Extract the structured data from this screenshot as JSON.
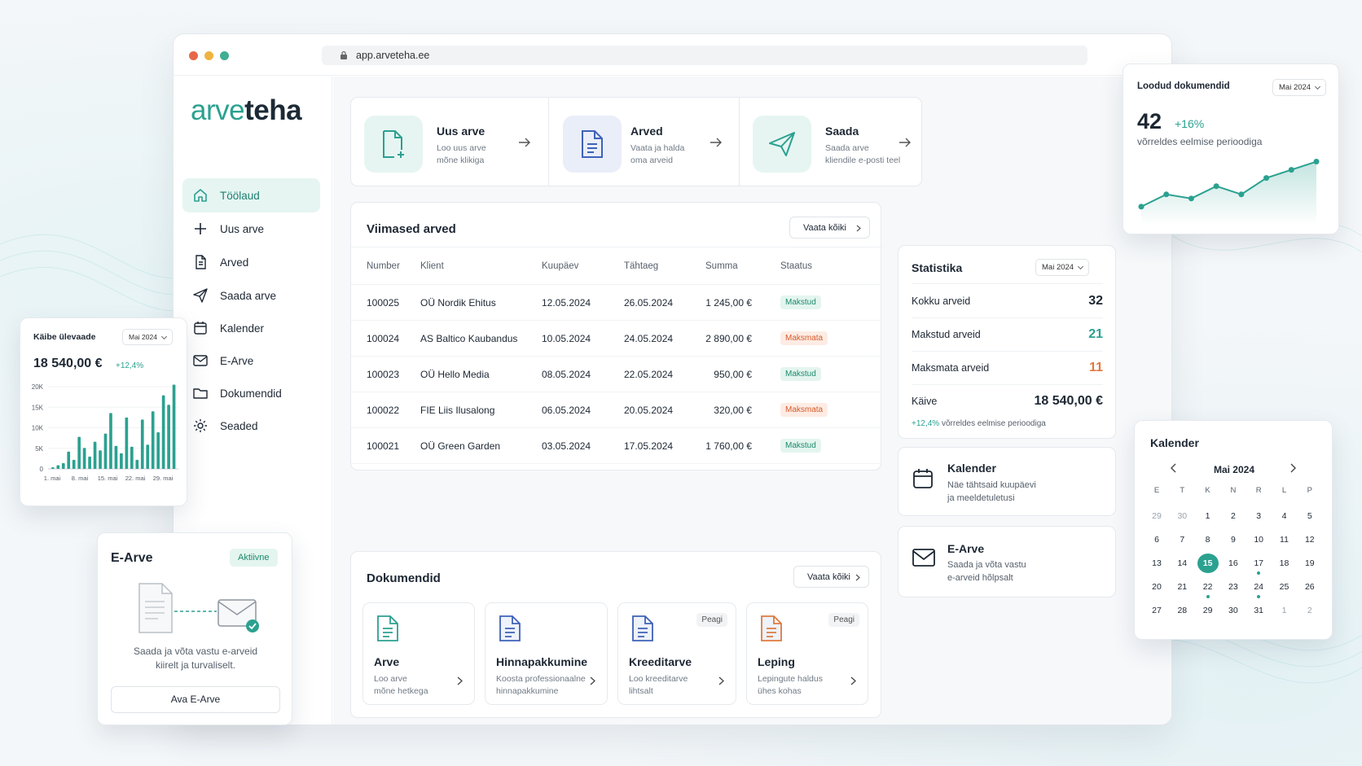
{
  "browser": {
    "url": "app.arveteha.ee"
  },
  "brand": {
    "logo_a": "arve",
    "logo_b": "teha",
    "accent": "#2ba190"
  },
  "sidebar": {
    "items": [
      {
        "label": "Töölaud",
        "icon": "home-icon",
        "active": true
      },
      {
        "label": "Uus arve",
        "icon": "plus-icon"
      },
      {
        "label": "Arved",
        "icon": "document-icon"
      },
      {
        "label": "Saada arve",
        "icon": "send-icon"
      },
      {
        "label": "Kalender",
        "icon": "calendar-icon"
      },
      {
        "label": "E-Arve",
        "icon": "mail-icon"
      },
      {
        "label": "Dokumendid",
        "icon": "folder-icon"
      },
      {
        "label": "Seaded",
        "icon": "gear-icon"
      }
    ]
  },
  "quick_actions": [
    {
      "title": "Uus arve",
      "desc1": "Loo uus arve",
      "desc2": "mõne klikiga",
      "icon": "new-document-icon"
    },
    {
      "title": "Arved",
      "desc1": "Vaata ja halda",
      "desc2": "oma arveid",
      "icon": "document-icon"
    },
    {
      "title": "Saada",
      "desc1": "Saada arve",
      "desc2": "kliendile e-posti teel",
      "icon": "send-icon"
    }
  ],
  "invoices": {
    "title": "Viimased arved",
    "view_all": "Vaata kõiki",
    "columns": [
      "Number",
      "Klient",
      "Kuupäev",
      "Tähtaeg",
      "Summa",
      "Staatus"
    ],
    "rows": [
      {
        "number": "100025",
        "client": "OÜ Nordik Ehitus",
        "date": "12.05.2024",
        "due": "26.05.2024",
        "sum": "1 245,00 €",
        "status": "Makstud"
      },
      {
        "number": "100024",
        "client": "AS Baltico Kaubandus",
        "date": "10.05.2024",
        "due": "24.05.2024",
        "sum": "2 890,00 €",
        "status": "Maksmata"
      },
      {
        "number": "100023",
        "client": "OÜ Hello Media",
        "date": "08.05.2024",
        "due": "22.05.2024",
        "sum": "950,00 €",
        "status": "Makstud"
      },
      {
        "number": "100022",
        "client": "FIE Liis Ilusalong",
        "date": "06.05.2024",
        "due": "20.05.2024",
        "sum": "320,00 €",
        "status": "Maksmata"
      },
      {
        "number": "100021",
        "client": "OÜ Green Garden",
        "date": "03.05.2024",
        "due": "17.05.2024",
        "sum": "1 760,00 €",
        "status": "Makstud"
      }
    ]
  },
  "documents": {
    "title": "Dokumendid",
    "view_all": "Vaata kõiki",
    "items": [
      {
        "title": "Arve",
        "desc1": "Loo arve",
        "desc2": "mõne hetkega",
        "badge": "",
        "color": "#2ba190"
      },
      {
        "title": "Hinnapakkumine",
        "desc1": "Koosta professionaalne",
        "desc2": "hinnapakkumine",
        "badge": "",
        "color": "#3f62b8"
      },
      {
        "title": "Kreeditarve",
        "desc1": "Loo kreeditarve",
        "desc2": "lihtsalt",
        "badge": "Peagi",
        "color": "#3f62b8"
      },
      {
        "title": "Leping",
        "desc1": "Lepingute haldus",
        "desc2": "ühes kohas",
        "badge": "Peagi",
        "color": "#e0793f"
      }
    ]
  },
  "stats": {
    "title": "Statistika",
    "period": "Mai 2024",
    "total_label": "Kokku arveid",
    "total": "32",
    "paid_label": "Makstud arveid",
    "paid": "21",
    "unpaid_label": "Maksmata arveid",
    "unpaid": "11",
    "turnover_label": "Käive",
    "turnover": "18 540,00 €",
    "change": "+12,4%",
    "change_text": "võrreldes eelmise perioodiga"
  },
  "calendar_info": {
    "title": "Kalender",
    "desc1": "Näe tähtsaid kuupäevi",
    "desc2": "ja meeldetuletusi"
  },
  "earve_info": {
    "title": "E-Arve",
    "desc1": "Saada ja võta vastu",
    "desc2": "e-arveid hõlpsalt"
  },
  "created_docs": {
    "title": "Loodud dokumendid",
    "period": "Mai 2024",
    "value": "42",
    "change": "+16%",
    "compare": "võrreldes eelmise perioodiga",
    "chart_data": {
      "type": "area",
      "values": [
        3,
        6,
        5,
        8,
        6,
        10,
        12,
        14
      ]
    }
  },
  "turnover_widget": {
    "title": "Käibe ülevaade",
    "period": "Mai 2024",
    "value": "18 540,00 €",
    "change": "+12,4%",
    "chart_data": {
      "type": "bar",
      "y_ticks": [
        "0",
        "5K",
        "10K",
        "15K",
        "20K"
      ],
      "ylim": [
        0,
        20000
      ],
      "x_ticks": [
        "1. mai",
        "8. mai",
        "15. mai",
        "22. mai",
        "29. mai"
      ],
      "values": [
        400,
        900,
        1400,
        4200,
        2200,
        7800,
        5100,
        3000,
        6600,
        4500,
        8600,
        13600,
        5600,
        3800,
        12500,
        5400,
        2200,
        12000,
        5900,
        14000,
        8900,
        17900,
        15600,
        20500
      ]
    }
  },
  "earve_widget": {
    "title": "E-Arve",
    "status": "Aktiivne",
    "text1": "Saada ja võta vastu e-arveid",
    "text2": "kiirelt ja turvaliselt.",
    "button": "Ava E-Arve"
  },
  "calendar_widget": {
    "title": "Kalender",
    "month": "Mai 2024",
    "weekdays": [
      "E",
      "T",
      "K",
      "N",
      "R",
      "L",
      "P"
    ],
    "days": [
      "29",
      "30",
      "1",
      "2",
      "3",
      "4",
      "5",
      "6",
      "7",
      "8",
      "9",
      "10",
      "11",
      "12",
      "13",
      "14",
      "15",
      "16",
      "17",
      "18",
      "19",
      "20",
      "21",
      "22",
      "23",
      "24",
      "25",
      "26",
      "27",
      "28",
      "29",
      "30",
      "31",
      "1",
      "2"
    ],
    "today": "15",
    "marked": [
      "17",
      "22",
      "24"
    ]
  }
}
